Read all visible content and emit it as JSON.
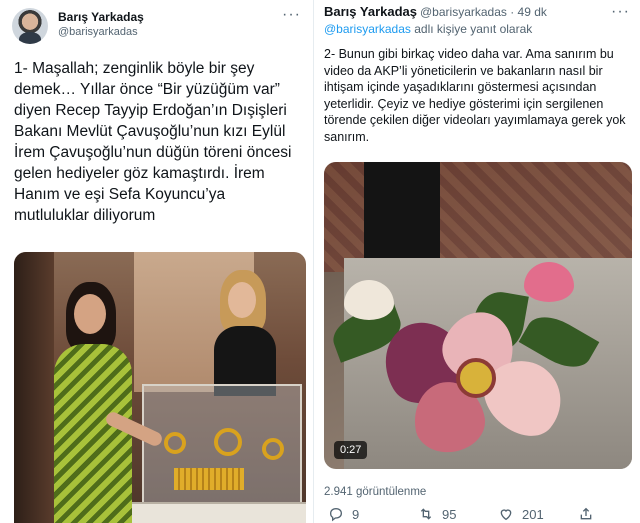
{
  "left_tweet": {
    "author_name": "Barış Yarkadaş",
    "author_handle": "@barisyarkadas",
    "more_icon": "more-dots-icon",
    "text_lines": [
      "1- Maşallah; zenginlik böyle bir şey",
      "demek… Yıllar önce “Bir yüzüğüm var”",
      "diyen Recep Tayyip Erdoğan’ın Dışişleri",
      "Bakanı Mevlüt Çavuşoğlu’nun kızı Eylül",
      "İrem Çavuşoğlu’nun düğün töreni öncesi",
      "gelen hediyeler göz kamaştırdı. İrem",
      "Hanım ve eşi Sefa Koyuncu’ya",
      "mutluluklar diliyorum"
    ]
  },
  "right_tweet": {
    "author_name": "Barış Yarkadaş",
    "header_meta": "@barisyarkadas · 49 dk",
    "reply_mention": "@barisyarkadas",
    "reply_suffix": " adlı kişiye yanıt olarak",
    "text": "2- Bunun gibi birkaç video daha var. Ama sanırım bu video da AKP’li yöneticilerin ve bakanların nasıl bir ihtişam içinde yaşadıklarını göstermesi açısından yeterlidir. Çeyiz ve hediye gösterimi için sergilenen törende çekilen diğer videoları yayımlamaya gerek yok sanırım.",
    "video_time": "0:27",
    "views": "2.941 görüntülenme",
    "actions": {
      "reply_count": "9",
      "retweet_count": "95",
      "like_count": "201"
    }
  },
  "colors": {
    "text": "#0f1419",
    "secondary": "#536471",
    "link": "#1d9bf0"
  }
}
